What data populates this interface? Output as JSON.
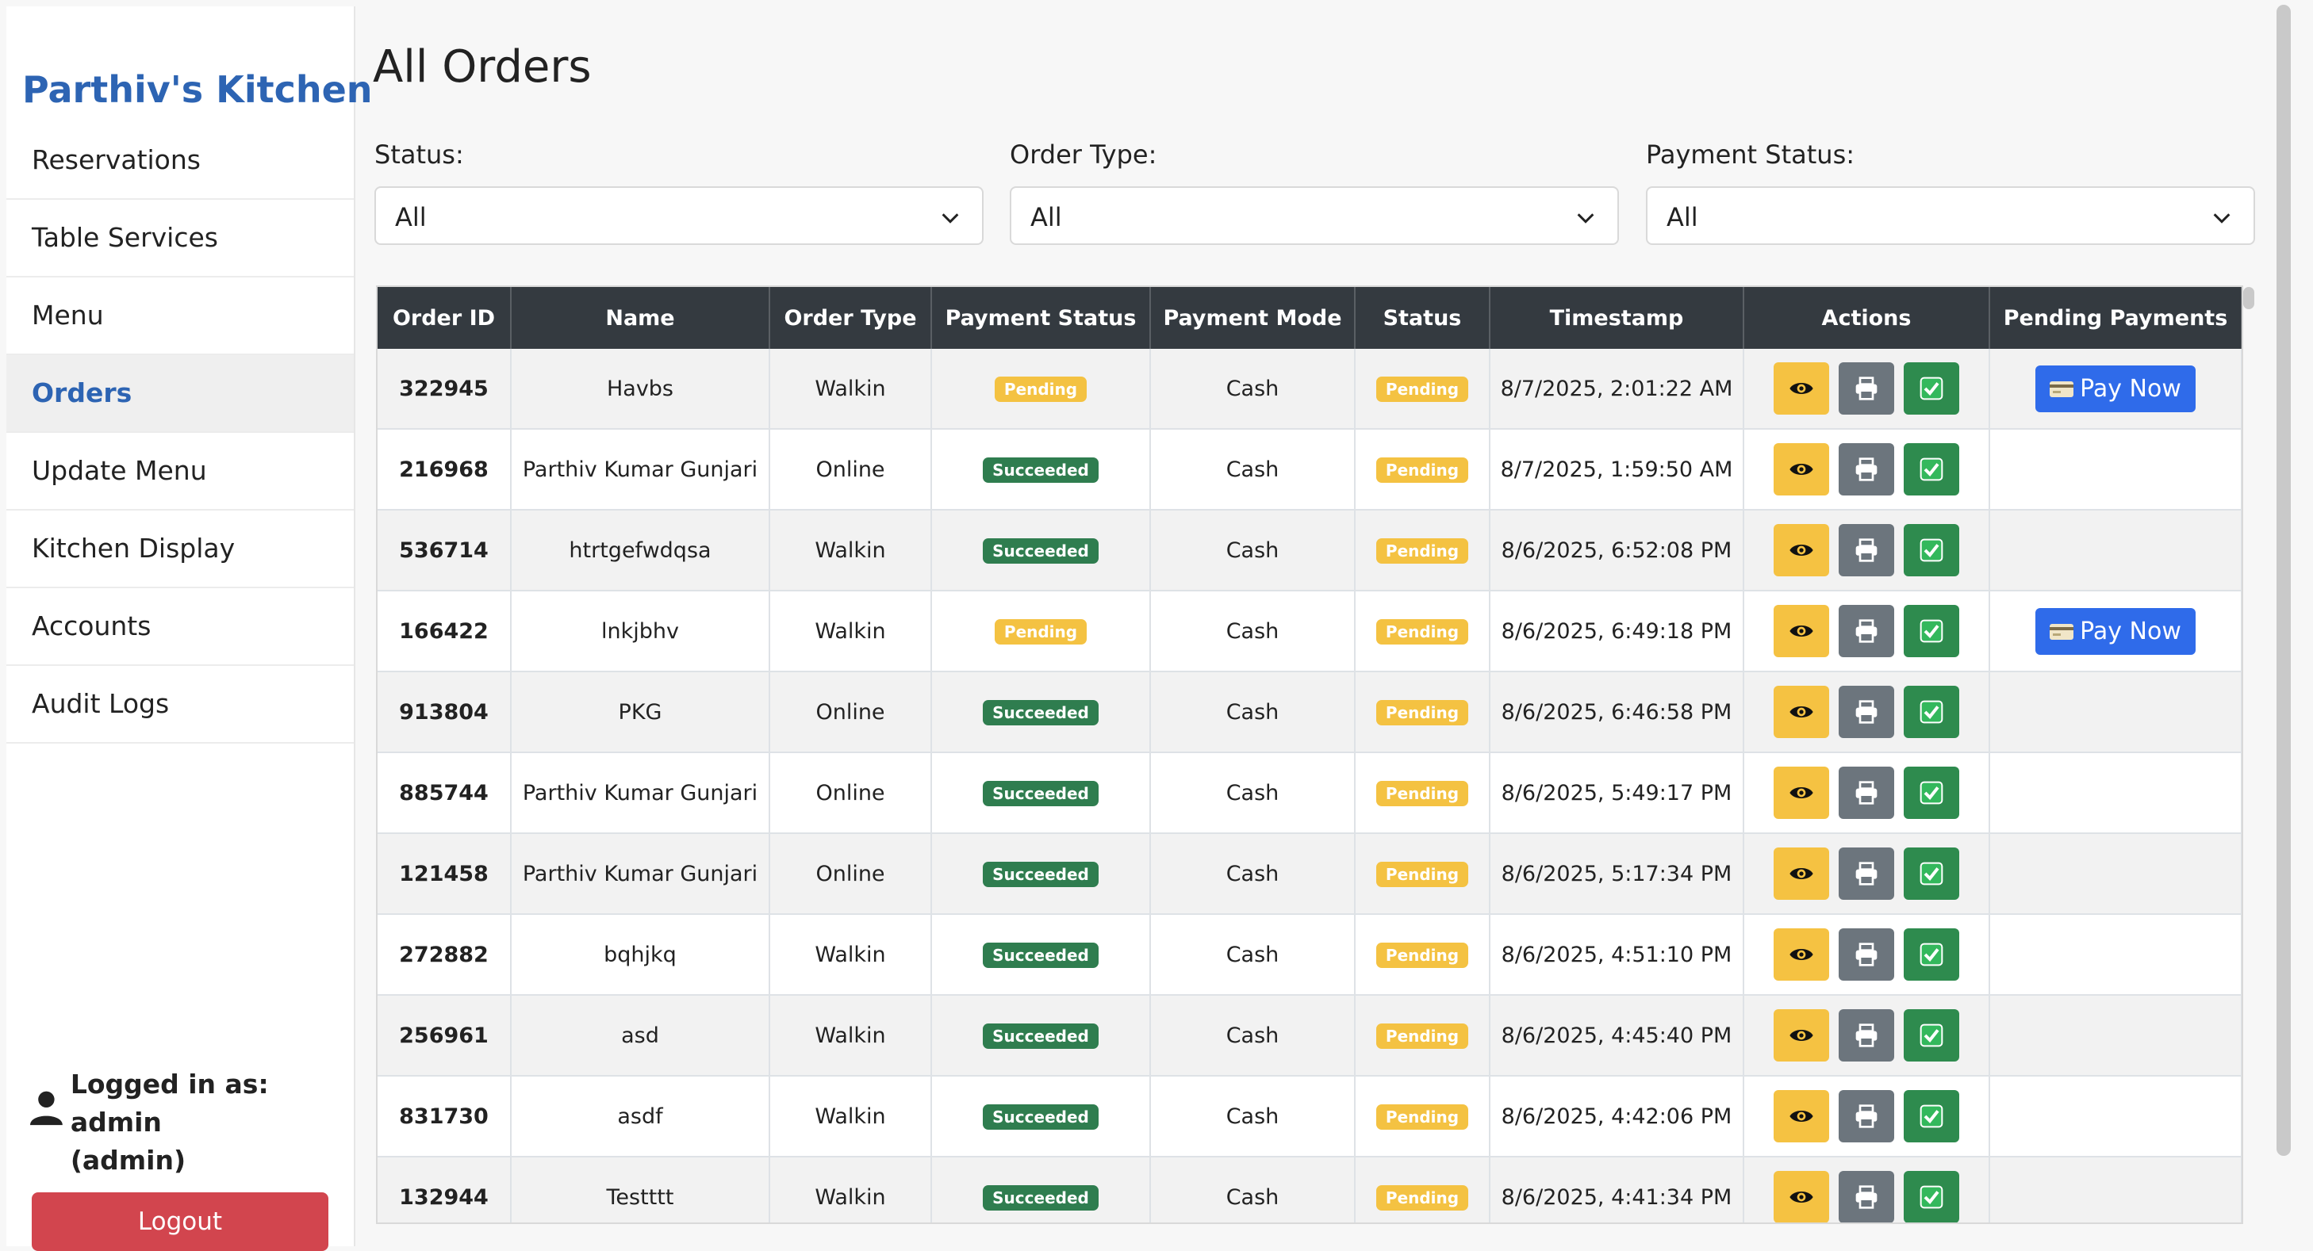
{
  "sidebar": {
    "brand": "Parthiv's Kitchen",
    "items": [
      {
        "label": "Reservations"
      },
      {
        "label": "Table Services"
      },
      {
        "label": "Menu"
      },
      {
        "label": "Orders"
      },
      {
        "label": "Update Menu"
      },
      {
        "label": "Kitchen Display"
      },
      {
        "label": "Accounts"
      },
      {
        "label": "Audit Logs"
      }
    ],
    "active_item": "Orders",
    "user_text": "Logged in as: admin (admin)",
    "user_line1": "Logged in as: admin",
    "user_line2": "(admin)",
    "logout_label": "Logout"
  },
  "main": {
    "title": "All Orders",
    "filters": {
      "status": {
        "label": "Status:",
        "value": "All"
      },
      "order_type": {
        "label": "Order Type:",
        "value": "All"
      },
      "payment_status": {
        "label": "Payment Status:",
        "value": "All"
      }
    }
  },
  "table": {
    "headers": [
      "Order ID",
      "Name",
      "Order Type",
      "Payment Status",
      "Payment Mode",
      "Status",
      "Timestamp",
      "Actions",
      "Pending Payments"
    ],
    "pay_now_label": "Pay Now",
    "rows": [
      {
        "id": "322945",
        "name": "Havbs",
        "type": "Walkin",
        "payment_status": "Pending",
        "mode": "Cash",
        "status": "Pending",
        "timestamp": "8/7/2025, 2:01:22 AM",
        "pending_payment": true
      },
      {
        "id": "216968",
        "name": "Parthiv Kumar Gunjari",
        "type": "Online",
        "payment_status": "Succeeded",
        "mode": "Cash",
        "status": "Pending",
        "timestamp": "8/7/2025, 1:59:50 AM",
        "pending_payment": false
      },
      {
        "id": "536714",
        "name": "htrtgefwdqsa",
        "type": "Walkin",
        "payment_status": "Succeeded",
        "mode": "Cash",
        "status": "Pending",
        "timestamp": "8/6/2025, 6:52:08 PM",
        "pending_payment": false
      },
      {
        "id": "166422",
        "name": "lnkjbhv",
        "type": "Walkin",
        "payment_status": "Pending",
        "mode": "Cash",
        "status": "Pending",
        "timestamp": "8/6/2025, 6:49:18 PM",
        "pending_payment": true
      },
      {
        "id": "913804",
        "name": "PKG",
        "type": "Online",
        "payment_status": "Succeeded",
        "mode": "Cash",
        "status": "Pending",
        "timestamp": "8/6/2025, 6:46:58 PM",
        "pending_payment": false
      },
      {
        "id": "885744",
        "name": "Parthiv Kumar Gunjari",
        "type": "Online",
        "payment_status": "Succeeded",
        "mode": "Cash",
        "status": "Pending",
        "timestamp": "8/6/2025, 5:49:17 PM",
        "pending_payment": false
      },
      {
        "id": "121458",
        "name": "Parthiv Kumar Gunjari",
        "type": "Online",
        "payment_status": "Succeeded",
        "mode": "Cash",
        "status": "Pending",
        "timestamp": "8/6/2025, 5:17:34 PM",
        "pending_payment": false
      },
      {
        "id": "272882",
        "name": "bqhjkq",
        "type": "Walkin",
        "payment_status": "Succeeded",
        "mode": "Cash",
        "status": "Pending",
        "timestamp": "8/6/2025, 4:51:10 PM",
        "pending_payment": false
      },
      {
        "id": "256961",
        "name": "asd",
        "type": "Walkin",
        "payment_status": "Succeeded",
        "mode": "Cash",
        "status": "Pending",
        "timestamp": "8/6/2025, 4:45:40 PM",
        "pending_payment": false
      },
      {
        "id": "831730",
        "name": "asdf",
        "type": "Walkin",
        "payment_status": "Succeeded",
        "mode": "Cash",
        "status": "Pending",
        "timestamp": "8/6/2025, 4:42:06 PM",
        "pending_payment": false
      },
      {
        "id": "132944",
        "name": "Testttt",
        "type": "Walkin",
        "payment_status": "Succeeded",
        "mode": "Cash",
        "status": "Pending",
        "timestamp": "8/6/2025, 4:41:34 PM",
        "pending_payment": false
      }
    ]
  },
  "icons": {
    "user": "user-icon",
    "chevron": "chevron-down-icon",
    "view": "eye-icon",
    "print": "printer-icon",
    "complete": "check-box-icon",
    "card": "credit-card-icon"
  },
  "colors": {
    "brand": "#2d64b3",
    "header_bg": "#343a40",
    "pending_badge": "#f4c242",
    "succeeded_badge": "#2f7d4f",
    "view_button": "#f5c242",
    "print_button": "#6c757d",
    "complete_button": "#2e8b4e",
    "pay_now": "#2f6bea",
    "logout": "#d2454e"
  }
}
